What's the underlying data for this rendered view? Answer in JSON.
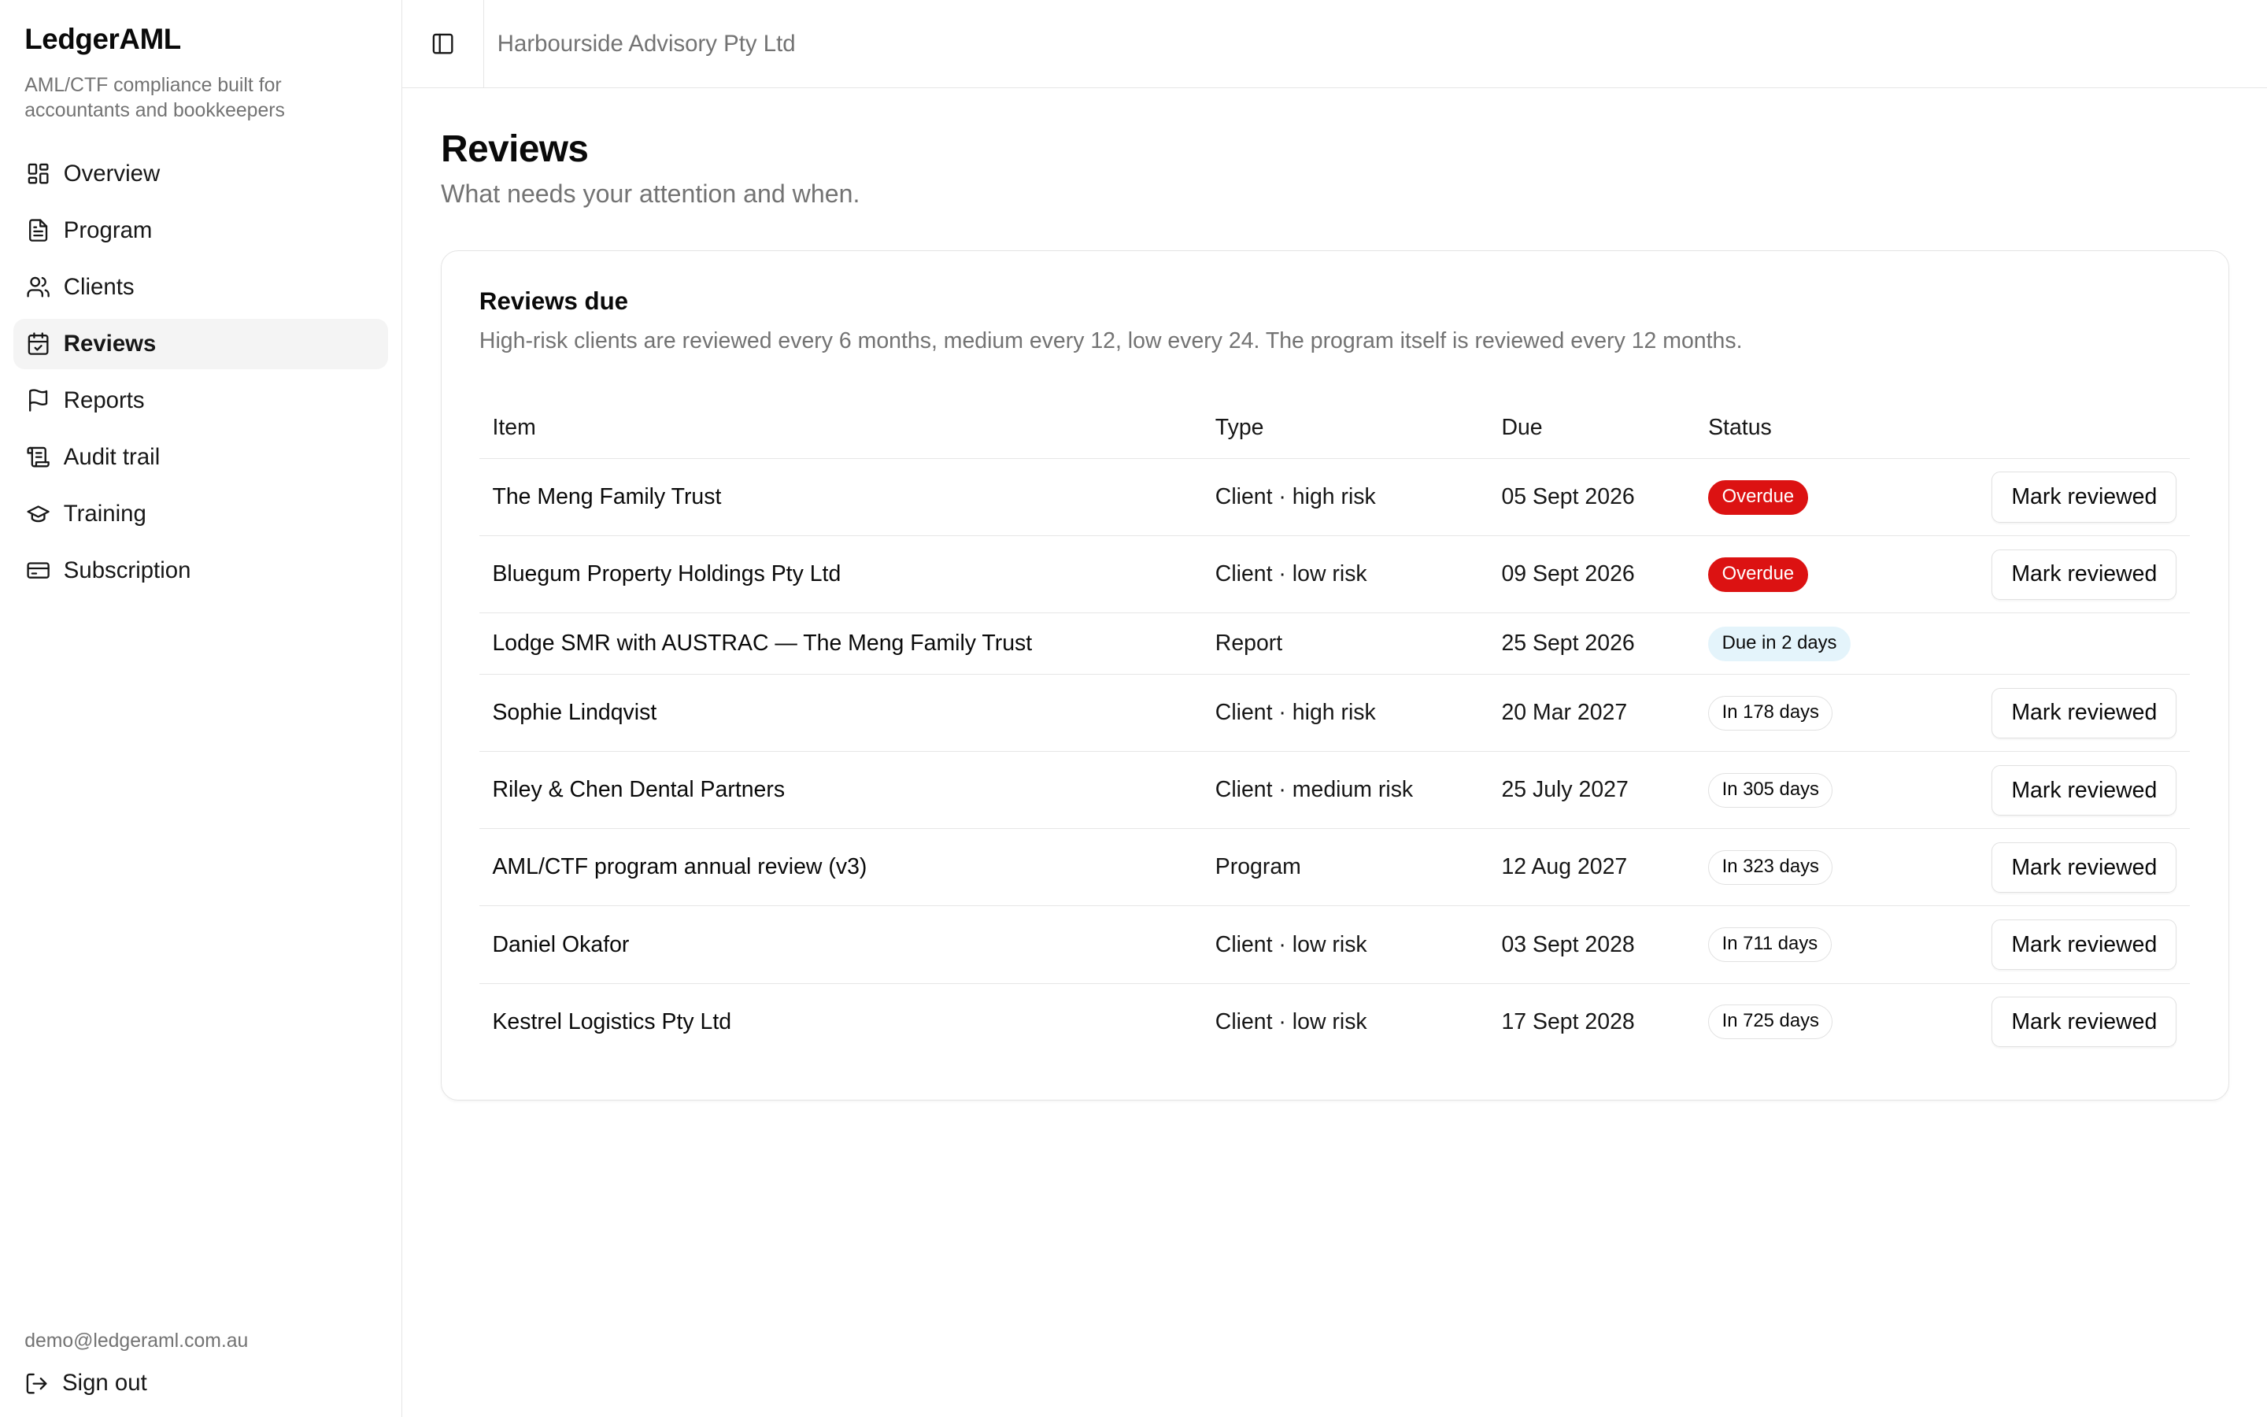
{
  "app": {
    "name": "LedgerAML",
    "tagline": "AML/CTF compliance built for accountants and bookkeepers"
  },
  "sidebar": {
    "items": [
      {
        "label": "Overview",
        "icon": "layout-dashboard-icon",
        "active": false
      },
      {
        "label": "Program",
        "icon": "file-text-icon",
        "active": false
      },
      {
        "label": "Clients",
        "icon": "users-icon",
        "active": false
      },
      {
        "label": "Reviews",
        "icon": "calendar-check-icon",
        "active": true
      },
      {
        "label": "Reports",
        "icon": "flag-icon",
        "active": false
      },
      {
        "label": "Audit trail",
        "icon": "scroll-icon",
        "active": false
      },
      {
        "label": "Training",
        "icon": "graduation-cap-icon",
        "active": false
      },
      {
        "label": "Subscription",
        "icon": "credit-card-icon",
        "active": false
      }
    ],
    "user_email": "demo@ledgeraml.com.au",
    "sign_out_label": "Sign out"
  },
  "topbar": {
    "organisation": "Harbourside Advisory Pty Ltd",
    "toggle_icon": "panel-left-icon"
  },
  "page": {
    "title": "Reviews",
    "subtitle": "What needs your attention and when."
  },
  "reviews_card": {
    "title": "Reviews due",
    "description": "High-risk clients are reviewed every 6 months, medium every 12, low every 24. The program itself is reviewed every 12 months.",
    "columns": [
      "Item",
      "Type",
      "Due",
      "Status"
    ],
    "rows": [
      {
        "item": "The Meng Family Trust",
        "type": "Client · high risk",
        "due": "05 Sept 2026",
        "status": "Overdue",
        "status_kind": "overdue",
        "action": "Mark reviewed"
      },
      {
        "item": "Bluegum Property Holdings Pty Ltd",
        "type": "Client · low risk",
        "due": "09 Sept 2026",
        "status": "Overdue",
        "status_kind": "overdue",
        "action": "Mark reviewed"
      },
      {
        "item": "Lodge SMR with AUSTRAC — The Meng Family Trust",
        "type": "Report",
        "due": "25 Sept 2026",
        "status": "Due in 2 days",
        "status_kind": "soon",
        "action": ""
      },
      {
        "item": "Sophie Lindqvist",
        "type": "Client · high risk",
        "due": "20 Mar 2027",
        "status": "In 178 days",
        "status_kind": "future",
        "action": "Mark reviewed"
      },
      {
        "item": "Riley & Chen Dental Partners",
        "type": "Client · medium risk",
        "due": "25 July 2027",
        "status": "In 305 days",
        "status_kind": "future",
        "action": "Mark reviewed"
      },
      {
        "item": "AML/CTF program annual review (v3)",
        "type": "Program",
        "due": "12 Aug 2027",
        "status": "In 323 days",
        "status_kind": "future",
        "action": "Mark reviewed"
      },
      {
        "item": "Daniel Okafor",
        "type": "Client · low risk",
        "due": "03 Sept 2028",
        "status": "In 711 days",
        "status_kind": "future",
        "action": "Mark reviewed"
      },
      {
        "item": "Kestrel Logistics Pty Ltd",
        "type": "Client · low risk",
        "due": "17 Sept 2028",
        "status": "In 725 days",
        "status_kind": "future",
        "action": "Mark reviewed"
      }
    ]
  },
  "colors": {
    "overdue": "#dc1212",
    "due_soon_bg": "#e4f4fb",
    "active_nav_bg": "#f4f4f4",
    "muted_text": "#737373",
    "border": "#e6e6e6"
  }
}
